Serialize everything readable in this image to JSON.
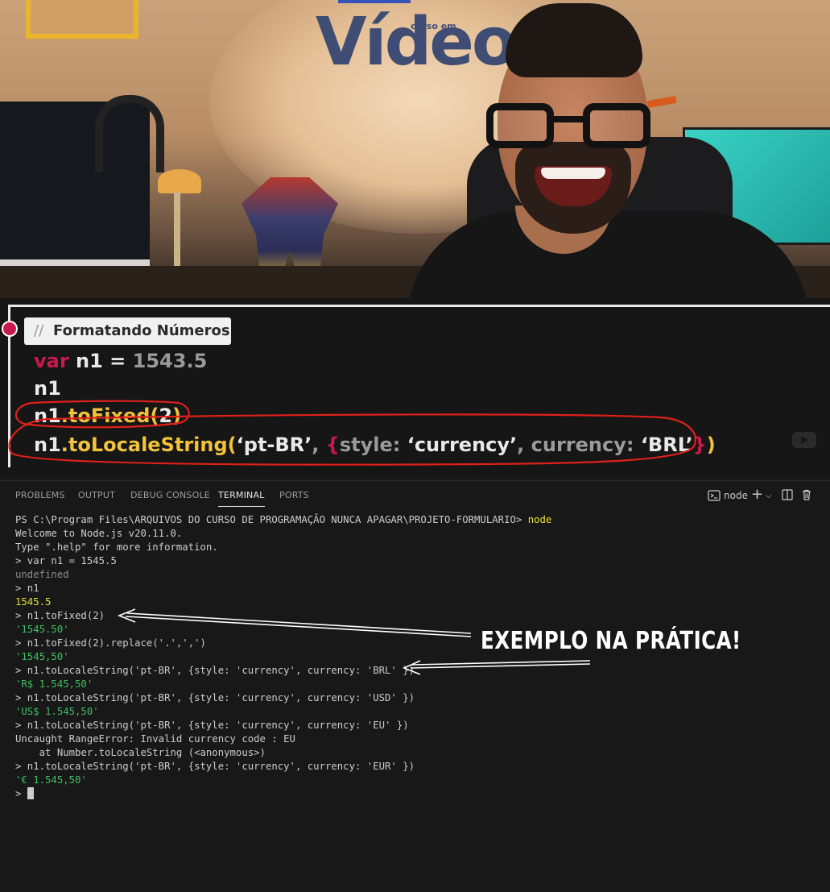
{
  "video": {
    "logo_text": "Vídeo",
    "logo_sub": "curso em"
  },
  "slide": {
    "title_slashes": "//",
    "title": "Formatando Números",
    "line1": {
      "kw": "var",
      "rest": " n1 = ",
      "num": "1543.5"
    },
    "line2": "n1",
    "line3": {
      "obj": "n1",
      "fn": ".toFixed(",
      "arg": "2",
      "close": ")"
    },
    "line4": {
      "obj": "n1",
      "fn": ".toLocaleString(",
      "arg1": "‘pt-BR’",
      "sep": ", ",
      "brace_open": "{",
      "k1": "style: ",
      "v1": "‘currency’",
      "sep2": ", ",
      "k2": "currency: ",
      "v2": "‘BRL’",
      "brace_close": "}",
      "close": ")"
    }
  },
  "panel": {
    "tabs": [
      "PROBLEMS",
      "OUTPUT",
      "DEBUG CONSOLE",
      "TERMINAL",
      "PORTS"
    ],
    "active_tab": "TERMINAL",
    "terminal_name": "node",
    "actions": {
      "terminal_icon": "terminal-icon",
      "add": "+",
      "dropdown": "chevron-down-icon",
      "split": "split-icon",
      "trash": "trash-icon"
    }
  },
  "terminal": {
    "prompt_path": "PS C:\\Program Files\\ARQUIVOS DO CURSO DE PROGRAMAÇÃO NUNCA APAGAR\\PROJETO-FORMULARIO> ",
    "prompt_cmd": "node",
    "lines": [
      {
        "text": "Welcome to Node.js v20.11.0.",
        "style": ""
      },
      {
        "text": "Type \".help\" for more information.",
        "style": ""
      },
      {
        "text": "> var n1 = 1545.5",
        "style": ""
      },
      {
        "text": "undefined",
        "style": "g"
      },
      {
        "text": "> n1",
        "style": ""
      },
      {
        "text": "1545.5",
        "style": "y"
      },
      {
        "text": "> n1.toFixed(2)",
        "style": ""
      },
      {
        "text": "'1545.50'",
        "style": "s"
      },
      {
        "text": "> n1.toFixed(2).replace('.',',')",
        "style": ""
      },
      {
        "text": "'1545,50'",
        "style": "s"
      },
      {
        "text": "> n1.toLocaleString('pt-BR', {style: 'currency', currency: 'BRL' })",
        "style": ""
      },
      {
        "text": "'R$ 1.545,50'",
        "style": "s"
      },
      {
        "text": "> n1.toLocaleString('pt-BR', {style: 'currency', currency: 'USD' })",
        "style": ""
      },
      {
        "text": "'US$ 1.545,50'",
        "style": "s"
      },
      {
        "text": "> n1.toLocaleString('pt-BR', {style: 'currency', currency: 'EU' })",
        "style": ""
      },
      {
        "text": "Uncaught RangeError: Invalid currency code : EU",
        "style": ""
      },
      {
        "text": "    at Number.toLocaleString (<anonymous>)",
        "style": ""
      },
      {
        "text": "> n1.toLocaleString('pt-BR', {style: 'currency', currency: 'EUR' })",
        "style": ""
      },
      {
        "text": "'€ 1.545,50'",
        "style": "s"
      }
    ],
    "last_prompt": "> "
  },
  "annotation": {
    "text": "EXEMPLO NA PRÁTICA!",
    "color": "#ffffff"
  },
  "colors": {
    "accent_red": "#c8194c",
    "accent_yellow": "#f2c23a",
    "terminal_bg": "#181818",
    "string_green": "#3fbf62",
    "number_yellow": "#e6e13a",
    "marker_red": "#e0201a"
  }
}
